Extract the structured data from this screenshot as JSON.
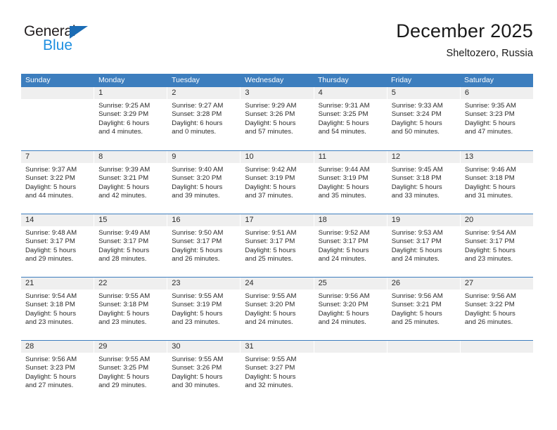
{
  "brand": {
    "name_top": "General",
    "name_bottom": "Blue",
    "triangle_color": "#1b6cb5",
    "blue_text_color": "#1f8fe0"
  },
  "header": {
    "title": "December 2025",
    "subtitle": "Sheltozero, Russia"
  },
  "theme": {
    "header_bg": "#3d7ebe",
    "header_text": "#ffffff",
    "daynum_band_bg": "#efefef",
    "cell_bg": "#ffffff",
    "text": "#2b2b2b",
    "week_divider": "#3d7ebe"
  },
  "weekdays": [
    "Sunday",
    "Monday",
    "Tuesday",
    "Wednesday",
    "Thursday",
    "Friday",
    "Saturday"
  ],
  "weeks": [
    [
      {
        "day": "",
        "lines": []
      },
      {
        "day": "1",
        "lines": [
          "Sunrise: 9:25 AM",
          "Sunset: 3:29 PM",
          "Daylight: 6 hours",
          "and 4 minutes."
        ]
      },
      {
        "day": "2",
        "lines": [
          "Sunrise: 9:27 AM",
          "Sunset: 3:28 PM",
          "Daylight: 6 hours",
          "and 0 minutes."
        ]
      },
      {
        "day": "3",
        "lines": [
          "Sunrise: 9:29 AM",
          "Sunset: 3:26 PM",
          "Daylight: 5 hours",
          "and 57 minutes."
        ]
      },
      {
        "day": "4",
        "lines": [
          "Sunrise: 9:31 AM",
          "Sunset: 3:25 PM",
          "Daylight: 5 hours",
          "and 54 minutes."
        ]
      },
      {
        "day": "5",
        "lines": [
          "Sunrise: 9:33 AM",
          "Sunset: 3:24 PM",
          "Daylight: 5 hours",
          "and 50 minutes."
        ]
      },
      {
        "day": "6",
        "lines": [
          "Sunrise: 9:35 AM",
          "Sunset: 3:23 PM",
          "Daylight: 5 hours",
          "and 47 minutes."
        ]
      }
    ],
    [
      {
        "day": "7",
        "lines": [
          "Sunrise: 9:37 AM",
          "Sunset: 3:22 PM",
          "Daylight: 5 hours",
          "and 44 minutes."
        ]
      },
      {
        "day": "8",
        "lines": [
          "Sunrise: 9:39 AM",
          "Sunset: 3:21 PM",
          "Daylight: 5 hours",
          "and 42 minutes."
        ]
      },
      {
        "day": "9",
        "lines": [
          "Sunrise: 9:40 AM",
          "Sunset: 3:20 PM",
          "Daylight: 5 hours",
          "and 39 minutes."
        ]
      },
      {
        "day": "10",
        "lines": [
          "Sunrise: 9:42 AM",
          "Sunset: 3:19 PM",
          "Daylight: 5 hours",
          "and 37 minutes."
        ]
      },
      {
        "day": "11",
        "lines": [
          "Sunrise: 9:44 AM",
          "Sunset: 3:19 PM",
          "Daylight: 5 hours",
          "and 35 minutes."
        ]
      },
      {
        "day": "12",
        "lines": [
          "Sunrise: 9:45 AM",
          "Sunset: 3:18 PM",
          "Daylight: 5 hours",
          "and 33 minutes."
        ]
      },
      {
        "day": "13",
        "lines": [
          "Sunrise: 9:46 AM",
          "Sunset: 3:18 PM",
          "Daylight: 5 hours",
          "and 31 minutes."
        ]
      }
    ],
    [
      {
        "day": "14",
        "lines": [
          "Sunrise: 9:48 AM",
          "Sunset: 3:17 PM",
          "Daylight: 5 hours",
          "and 29 minutes."
        ]
      },
      {
        "day": "15",
        "lines": [
          "Sunrise: 9:49 AM",
          "Sunset: 3:17 PM",
          "Daylight: 5 hours",
          "and 28 minutes."
        ]
      },
      {
        "day": "16",
        "lines": [
          "Sunrise: 9:50 AM",
          "Sunset: 3:17 PM",
          "Daylight: 5 hours",
          "and 26 minutes."
        ]
      },
      {
        "day": "17",
        "lines": [
          "Sunrise: 9:51 AM",
          "Sunset: 3:17 PM",
          "Daylight: 5 hours",
          "and 25 minutes."
        ]
      },
      {
        "day": "18",
        "lines": [
          "Sunrise: 9:52 AM",
          "Sunset: 3:17 PM",
          "Daylight: 5 hours",
          "and 24 minutes."
        ]
      },
      {
        "day": "19",
        "lines": [
          "Sunrise: 9:53 AM",
          "Sunset: 3:17 PM",
          "Daylight: 5 hours",
          "and 24 minutes."
        ]
      },
      {
        "day": "20",
        "lines": [
          "Sunrise: 9:54 AM",
          "Sunset: 3:17 PM",
          "Daylight: 5 hours",
          "and 23 minutes."
        ]
      }
    ],
    [
      {
        "day": "21",
        "lines": [
          "Sunrise: 9:54 AM",
          "Sunset: 3:18 PM",
          "Daylight: 5 hours",
          "and 23 minutes."
        ]
      },
      {
        "day": "22",
        "lines": [
          "Sunrise: 9:55 AM",
          "Sunset: 3:18 PM",
          "Daylight: 5 hours",
          "and 23 minutes."
        ]
      },
      {
        "day": "23",
        "lines": [
          "Sunrise: 9:55 AM",
          "Sunset: 3:19 PM",
          "Daylight: 5 hours",
          "and 23 minutes."
        ]
      },
      {
        "day": "24",
        "lines": [
          "Sunrise: 9:55 AM",
          "Sunset: 3:20 PM",
          "Daylight: 5 hours",
          "and 24 minutes."
        ]
      },
      {
        "day": "25",
        "lines": [
          "Sunrise: 9:56 AM",
          "Sunset: 3:20 PM",
          "Daylight: 5 hours",
          "and 24 minutes."
        ]
      },
      {
        "day": "26",
        "lines": [
          "Sunrise: 9:56 AM",
          "Sunset: 3:21 PM",
          "Daylight: 5 hours",
          "and 25 minutes."
        ]
      },
      {
        "day": "27",
        "lines": [
          "Sunrise: 9:56 AM",
          "Sunset: 3:22 PM",
          "Daylight: 5 hours",
          "and 26 minutes."
        ]
      }
    ],
    [
      {
        "day": "28",
        "lines": [
          "Sunrise: 9:56 AM",
          "Sunset: 3:23 PM",
          "Daylight: 5 hours",
          "and 27 minutes."
        ]
      },
      {
        "day": "29",
        "lines": [
          "Sunrise: 9:55 AM",
          "Sunset: 3:25 PM",
          "Daylight: 5 hours",
          "and 29 minutes."
        ]
      },
      {
        "day": "30",
        "lines": [
          "Sunrise: 9:55 AM",
          "Sunset: 3:26 PM",
          "Daylight: 5 hours",
          "and 30 minutes."
        ]
      },
      {
        "day": "31",
        "lines": [
          "Sunrise: 9:55 AM",
          "Sunset: 3:27 PM",
          "Daylight: 5 hours",
          "and 32 minutes."
        ]
      },
      {
        "day": "",
        "lines": []
      },
      {
        "day": "",
        "lines": []
      },
      {
        "day": "",
        "lines": []
      }
    ]
  ]
}
